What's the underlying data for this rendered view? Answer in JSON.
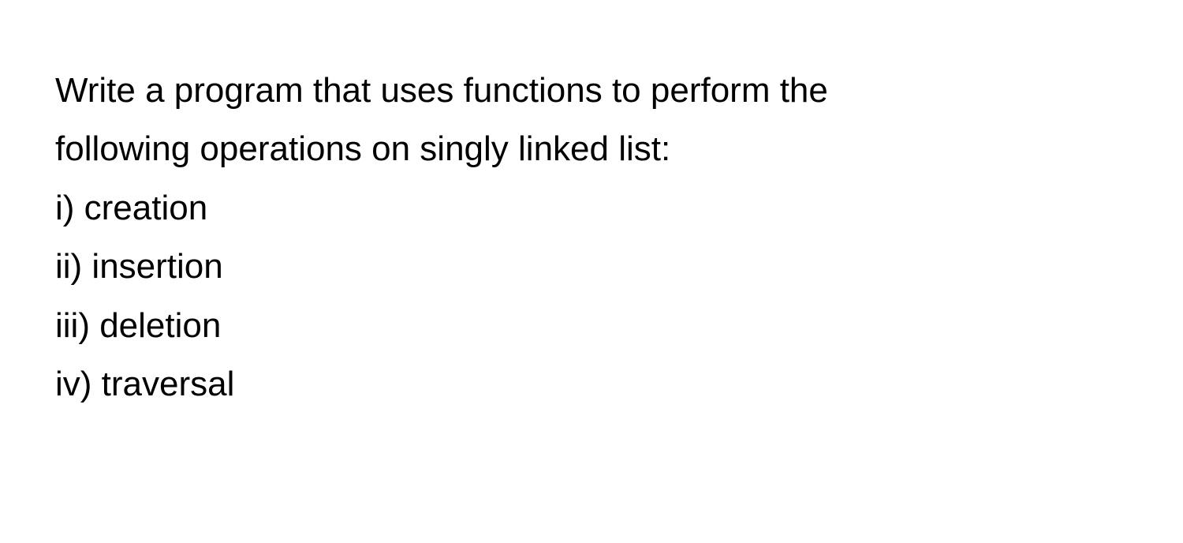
{
  "document": {
    "intro_line1": "Write a program that uses functions to perform the",
    "intro_line2": "following operations on singly linked list:",
    "items": [
      "i) creation",
      "ii) insertion",
      "iii) deletion",
      "iv) traversal"
    ]
  }
}
